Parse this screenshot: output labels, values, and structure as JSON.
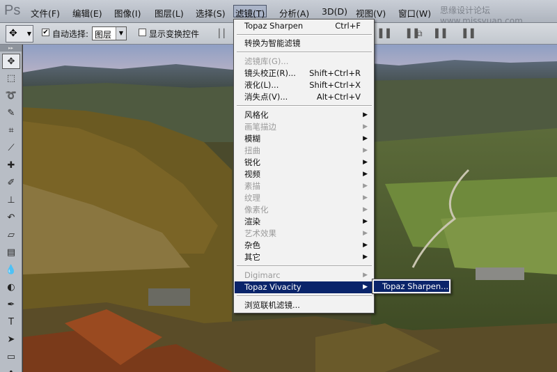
{
  "app": {
    "logo": "Ps",
    "watermark": "思缘设计论坛 www.missyuan.com"
  },
  "menubar": {
    "items": [
      {
        "label": "文件(F)"
      },
      {
        "label": "编辑(E)"
      },
      {
        "label": "图像(I)"
      },
      {
        "label": "图层(L)"
      },
      {
        "label": "选择(S)"
      },
      {
        "label": "滤镜(T)"
      },
      {
        "label": "分析(A)"
      },
      {
        "label": "3D(D)"
      },
      {
        "label": "视图(V)"
      },
      {
        "label": "窗口(W)"
      }
    ]
  },
  "options": {
    "auto_select_label": "自动选择:",
    "auto_select_checked": "✔",
    "auto_select_value": "图层",
    "show_transform_label": "显示变换控件"
  },
  "filter_menu": {
    "items": [
      {
        "label": "Topaz Sharpen",
        "shortcut": "Ctrl+F"
      },
      {
        "label": "转换为智能滤镜"
      },
      {
        "label": "滤镜库(G)..."
      },
      {
        "label": "镜头校正(R)...",
        "shortcut": "Shift+Ctrl+R"
      },
      {
        "label": "液化(L)...",
        "shortcut": "Shift+Ctrl+X"
      },
      {
        "label": "消失点(V)...",
        "shortcut": "Alt+Ctrl+V"
      },
      {
        "label": "风格化"
      },
      {
        "label": "画笔描边"
      },
      {
        "label": "模糊"
      },
      {
        "label": "扭曲"
      },
      {
        "label": "锐化"
      },
      {
        "label": "视频"
      },
      {
        "label": "素描"
      },
      {
        "label": "纹理"
      },
      {
        "label": "像素化"
      },
      {
        "label": "渲染"
      },
      {
        "label": "艺术效果"
      },
      {
        "label": "杂色"
      },
      {
        "label": "其它"
      },
      {
        "label": "Digimarc"
      },
      {
        "label": "Topaz Vivacity"
      },
      {
        "label": "浏览联机滤镜..."
      }
    ],
    "submenu_arrow": "▶"
  },
  "submenu": {
    "label": "Topaz Sharpen..."
  }
}
